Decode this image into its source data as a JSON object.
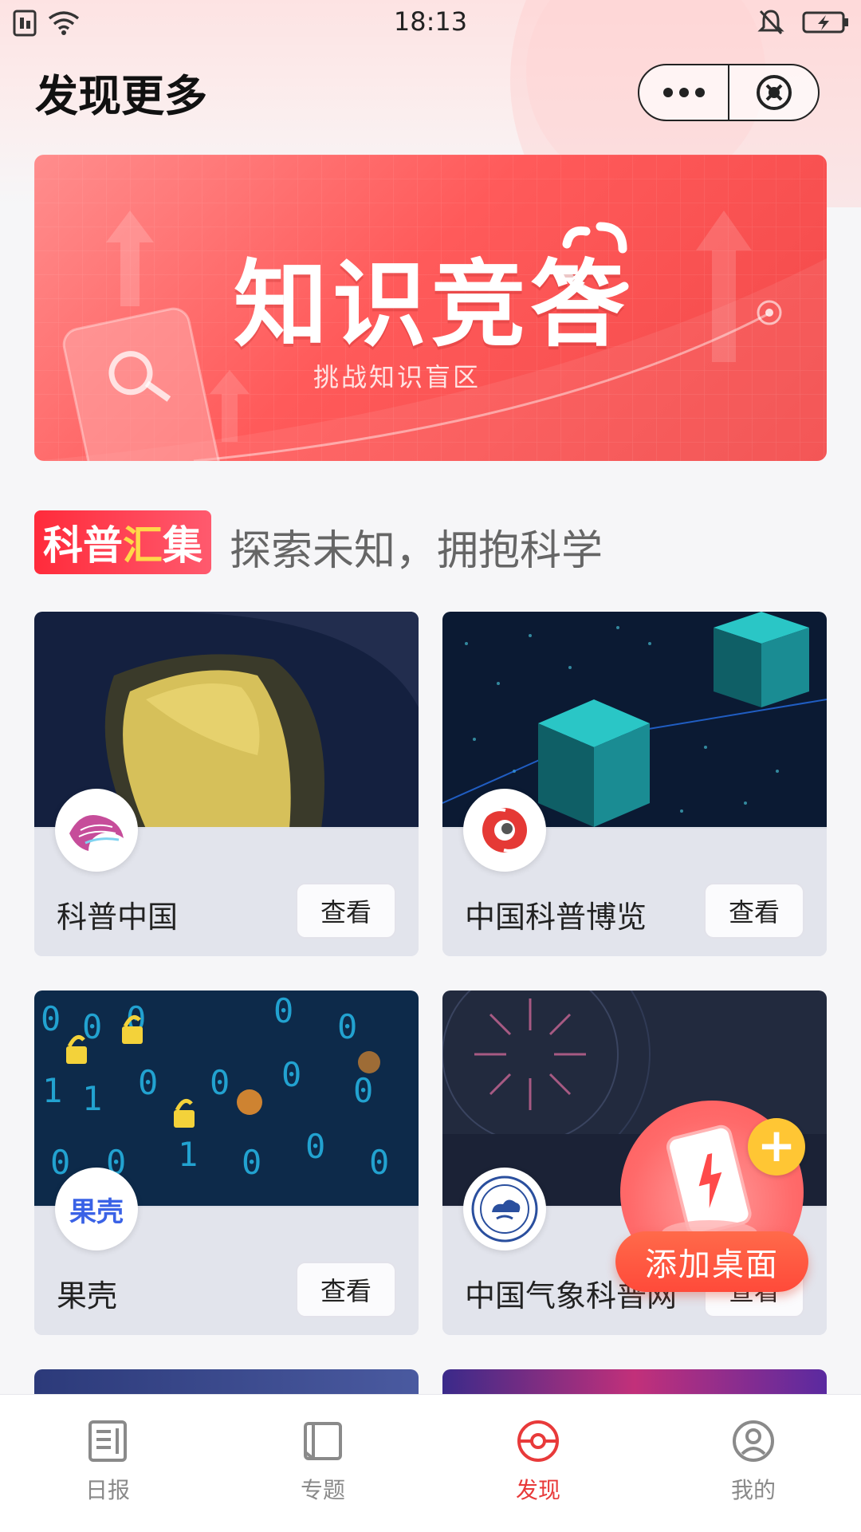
{
  "status_bar": {
    "time": "18:13"
  },
  "header": {
    "title": "发现更多"
  },
  "banner": {
    "title": "知识竞答",
    "subtitle": "挑战知识盲区"
  },
  "section": {
    "badge_part1": "科普",
    "badge_part2": "汇",
    "badge_part3": "集",
    "tagline": "探索未知，拥抱科学"
  },
  "cards": [
    {
      "name": "科普中国",
      "button": "查看"
    },
    {
      "name": "中国科普博览",
      "button": "查看"
    },
    {
      "name": "果壳",
      "logo_text": "果壳",
      "button": "查看"
    },
    {
      "name": "中国气象科普网",
      "button": "查看"
    }
  ],
  "floating": {
    "label": "添加桌面",
    "plus": "+"
  },
  "bottom_nav": [
    {
      "label": "日报",
      "icon": "newspaper-icon"
    },
    {
      "label": "专题",
      "icon": "book-icon"
    },
    {
      "label": "发现",
      "icon": "discover-icon",
      "active": true
    },
    {
      "label": "我的",
      "icon": "profile-icon"
    }
  ],
  "colors": {
    "accent": "#e83a3a",
    "banner": "#ff5a5a",
    "badge_highlight": "#ffd84a"
  }
}
